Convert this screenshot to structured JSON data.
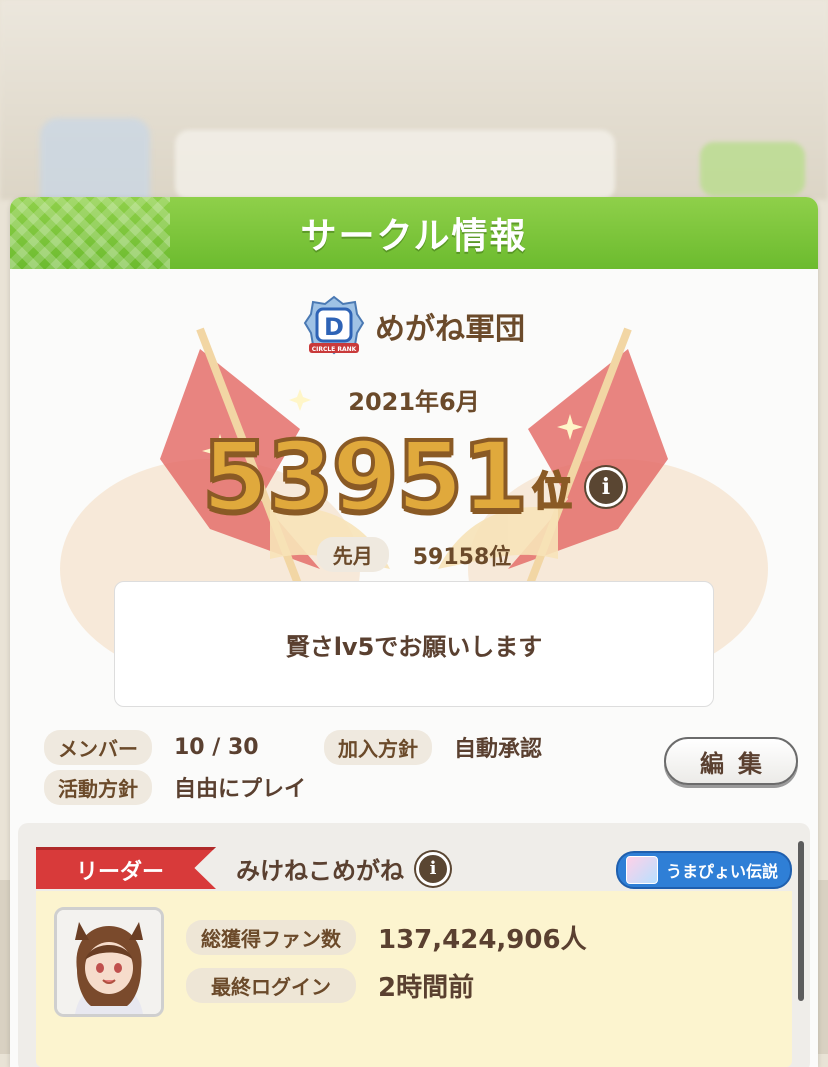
{
  "dialog": {
    "title": "サークル情報"
  },
  "circle": {
    "name": "めがね軍団",
    "badge_letter": "D",
    "badge_caption": "CIRCLE RANK",
    "month": "2021年6月",
    "rank": "53951",
    "rank_suffix": "位",
    "prev_label": "先月",
    "prev_rank": "59158位",
    "message": "賢さlv5でお願いします"
  },
  "info": {
    "member_label": "メンバー",
    "member_value": "10 / 30",
    "join_label": "加入方針",
    "join_value": "自動承認",
    "activity_label": "活動方針",
    "activity_value": "自由にプレイ",
    "edit_label": "編集"
  },
  "leader": {
    "role_label": "リーダー",
    "name": "みけねこめがね",
    "title_badge": "うまぴょい伝説",
    "fans_label": "総獲得ファン数",
    "fans_value": "137,424,906人",
    "login_label": "最終ログイン",
    "login_value": "2時間前"
  },
  "icons": {
    "info": "info-icon"
  },
  "colors": {
    "header_green": "#7dc63b",
    "text_brown": "#5a4030",
    "rank_gold": "#e0a93c",
    "leader_red": "#d83a3a",
    "badge_blue": "#2f7fd6"
  }
}
